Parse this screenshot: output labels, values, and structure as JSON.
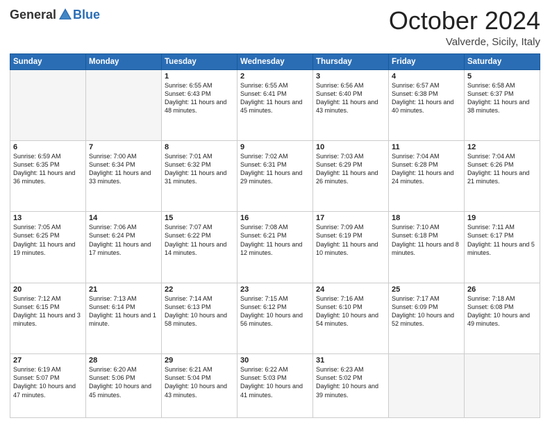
{
  "logo": {
    "general": "General",
    "blue": "Blue"
  },
  "header": {
    "month": "October 2024",
    "location": "Valverde, Sicily, Italy"
  },
  "weekdays": [
    "Sunday",
    "Monday",
    "Tuesday",
    "Wednesday",
    "Thursday",
    "Friday",
    "Saturday"
  ],
  "weeks": [
    [
      {
        "day": "",
        "info": ""
      },
      {
        "day": "",
        "info": ""
      },
      {
        "day": "1",
        "info": "Sunrise: 6:55 AM\nSunset: 6:43 PM\nDaylight: 11 hours and 48 minutes."
      },
      {
        "day": "2",
        "info": "Sunrise: 6:55 AM\nSunset: 6:41 PM\nDaylight: 11 hours and 45 minutes."
      },
      {
        "day": "3",
        "info": "Sunrise: 6:56 AM\nSunset: 6:40 PM\nDaylight: 11 hours and 43 minutes."
      },
      {
        "day": "4",
        "info": "Sunrise: 6:57 AM\nSunset: 6:38 PM\nDaylight: 11 hours and 40 minutes."
      },
      {
        "day": "5",
        "info": "Sunrise: 6:58 AM\nSunset: 6:37 PM\nDaylight: 11 hours and 38 minutes."
      }
    ],
    [
      {
        "day": "6",
        "info": "Sunrise: 6:59 AM\nSunset: 6:35 PM\nDaylight: 11 hours and 36 minutes."
      },
      {
        "day": "7",
        "info": "Sunrise: 7:00 AM\nSunset: 6:34 PM\nDaylight: 11 hours and 33 minutes."
      },
      {
        "day": "8",
        "info": "Sunrise: 7:01 AM\nSunset: 6:32 PM\nDaylight: 11 hours and 31 minutes."
      },
      {
        "day": "9",
        "info": "Sunrise: 7:02 AM\nSunset: 6:31 PM\nDaylight: 11 hours and 29 minutes."
      },
      {
        "day": "10",
        "info": "Sunrise: 7:03 AM\nSunset: 6:29 PM\nDaylight: 11 hours and 26 minutes."
      },
      {
        "day": "11",
        "info": "Sunrise: 7:04 AM\nSunset: 6:28 PM\nDaylight: 11 hours and 24 minutes."
      },
      {
        "day": "12",
        "info": "Sunrise: 7:04 AM\nSunset: 6:26 PM\nDaylight: 11 hours and 21 minutes."
      }
    ],
    [
      {
        "day": "13",
        "info": "Sunrise: 7:05 AM\nSunset: 6:25 PM\nDaylight: 11 hours and 19 minutes."
      },
      {
        "day": "14",
        "info": "Sunrise: 7:06 AM\nSunset: 6:24 PM\nDaylight: 11 hours and 17 minutes."
      },
      {
        "day": "15",
        "info": "Sunrise: 7:07 AM\nSunset: 6:22 PM\nDaylight: 11 hours and 14 minutes."
      },
      {
        "day": "16",
        "info": "Sunrise: 7:08 AM\nSunset: 6:21 PM\nDaylight: 11 hours and 12 minutes."
      },
      {
        "day": "17",
        "info": "Sunrise: 7:09 AM\nSunset: 6:19 PM\nDaylight: 11 hours and 10 minutes."
      },
      {
        "day": "18",
        "info": "Sunrise: 7:10 AM\nSunset: 6:18 PM\nDaylight: 11 hours and 8 minutes."
      },
      {
        "day": "19",
        "info": "Sunrise: 7:11 AM\nSunset: 6:17 PM\nDaylight: 11 hours and 5 minutes."
      }
    ],
    [
      {
        "day": "20",
        "info": "Sunrise: 7:12 AM\nSunset: 6:15 PM\nDaylight: 11 hours and 3 minutes."
      },
      {
        "day": "21",
        "info": "Sunrise: 7:13 AM\nSunset: 6:14 PM\nDaylight: 11 hours and 1 minute."
      },
      {
        "day": "22",
        "info": "Sunrise: 7:14 AM\nSunset: 6:13 PM\nDaylight: 10 hours and 58 minutes."
      },
      {
        "day": "23",
        "info": "Sunrise: 7:15 AM\nSunset: 6:12 PM\nDaylight: 10 hours and 56 minutes."
      },
      {
        "day": "24",
        "info": "Sunrise: 7:16 AM\nSunset: 6:10 PM\nDaylight: 10 hours and 54 minutes."
      },
      {
        "day": "25",
        "info": "Sunrise: 7:17 AM\nSunset: 6:09 PM\nDaylight: 10 hours and 52 minutes."
      },
      {
        "day": "26",
        "info": "Sunrise: 7:18 AM\nSunset: 6:08 PM\nDaylight: 10 hours and 49 minutes."
      }
    ],
    [
      {
        "day": "27",
        "info": "Sunrise: 6:19 AM\nSunset: 5:07 PM\nDaylight: 10 hours and 47 minutes."
      },
      {
        "day": "28",
        "info": "Sunrise: 6:20 AM\nSunset: 5:06 PM\nDaylight: 10 hours and 45 minutes."
      },
      {
        "day": "29",
        "info": "Sunrise: 6:21 AM\nSunset: 5:04 PM\nDaylight: 10 hours and 43 minutes."
      },
      {
        "day": "30",
        "info": "Sunrise: 6:22 AM\nSunset: 5:03 PM\nDaylight: 10 hours and 41 minutes."
      },
      {
        "day": "31",
        "info": "Sunrise: 6:23 AM\nSunset: 5:02 PM\nDaylight: 10 hours and 39 minutes."
      },
      {
        "day": "",
        "info": ""
      },
      {
        "day": "",
        "info": ""
      }
    ]
  ]
}
